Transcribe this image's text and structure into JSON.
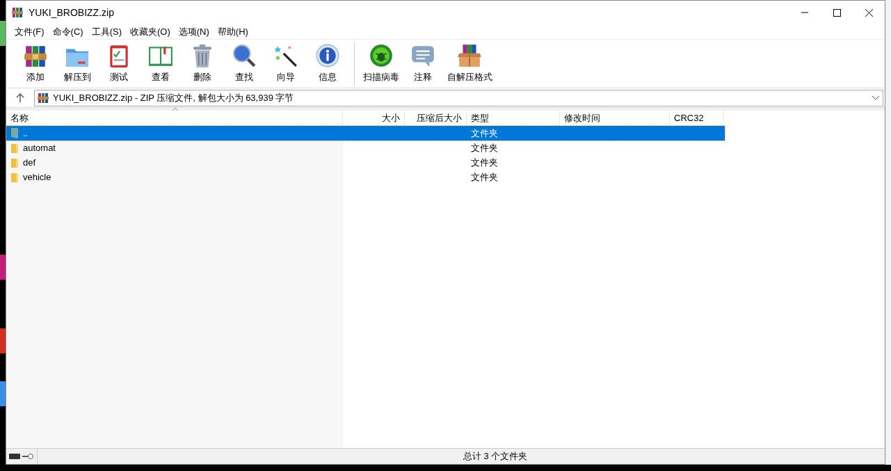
{
  "window": {
    "title": "YUKI_BROBIZZ.zip"
  },
  "menu": [
    "文件(F)",
    "命令(C)",
    "工具(S)",
    "收藏夹(O)",
    "选项(N)",
    "帮助(H)"
  ],
  "toolbar": [
    {
      "kind": "add",
      "label": "添加"
    },
    {
      "kind": "extract",
      "label": "解压到"
    },
    {
      "kind": "test",
      "label": "测试"
    },
    {
      "kind": "view",
      "label": "查看"
    },
    {
      "kind": "delete",
      "label": "删除"
    },
    {
      "kind": "find",
      "label": "查找"
    },
    {
      "kind": "wizard",
      "label": "向导"
    },
    {
      "kind": "info",
      "label": "信息"
    },
    {
      "kind": "separator"
    },
    {
      "kind": "scan",
      "label": "扫描病毒"
    },
    {
      "kind": "comment",
      "label": "注释"
    },
    {
      "kind": "sfx",
      "label": "自解压格式"
    }
  ],
  "address": {
    "value": "YUKI_BROBIZZ.zip - ZIP 压缩文件, 解包大小为 63,939 字节"
  },
  "table": {
    "columns": [
      "名称",
      "大小",
      "压缩后大小",
      "类型",
      "修改时间",
      "CRC32"
    ],
    "rows": [
      {
        "kind": "parent",
        "name": "..",
        "type": "文件夹",
        "selected": true
      },
      {
        "kind": "folder",
        "name": "automat",
        "type": "文件夹",
        "selected": false
      },
      {
        "kind": "folder",
        "name": "def",
        "type": "文件夹",
        "selected": false
      },
      {
        "kind": "folder",
        "name": "vehicle",
        "type": "文件夹",
        "selected": false
      }
    ]
  },
  "status_bar": {
    "text": "总计 3 个文件夹"
  }
}
